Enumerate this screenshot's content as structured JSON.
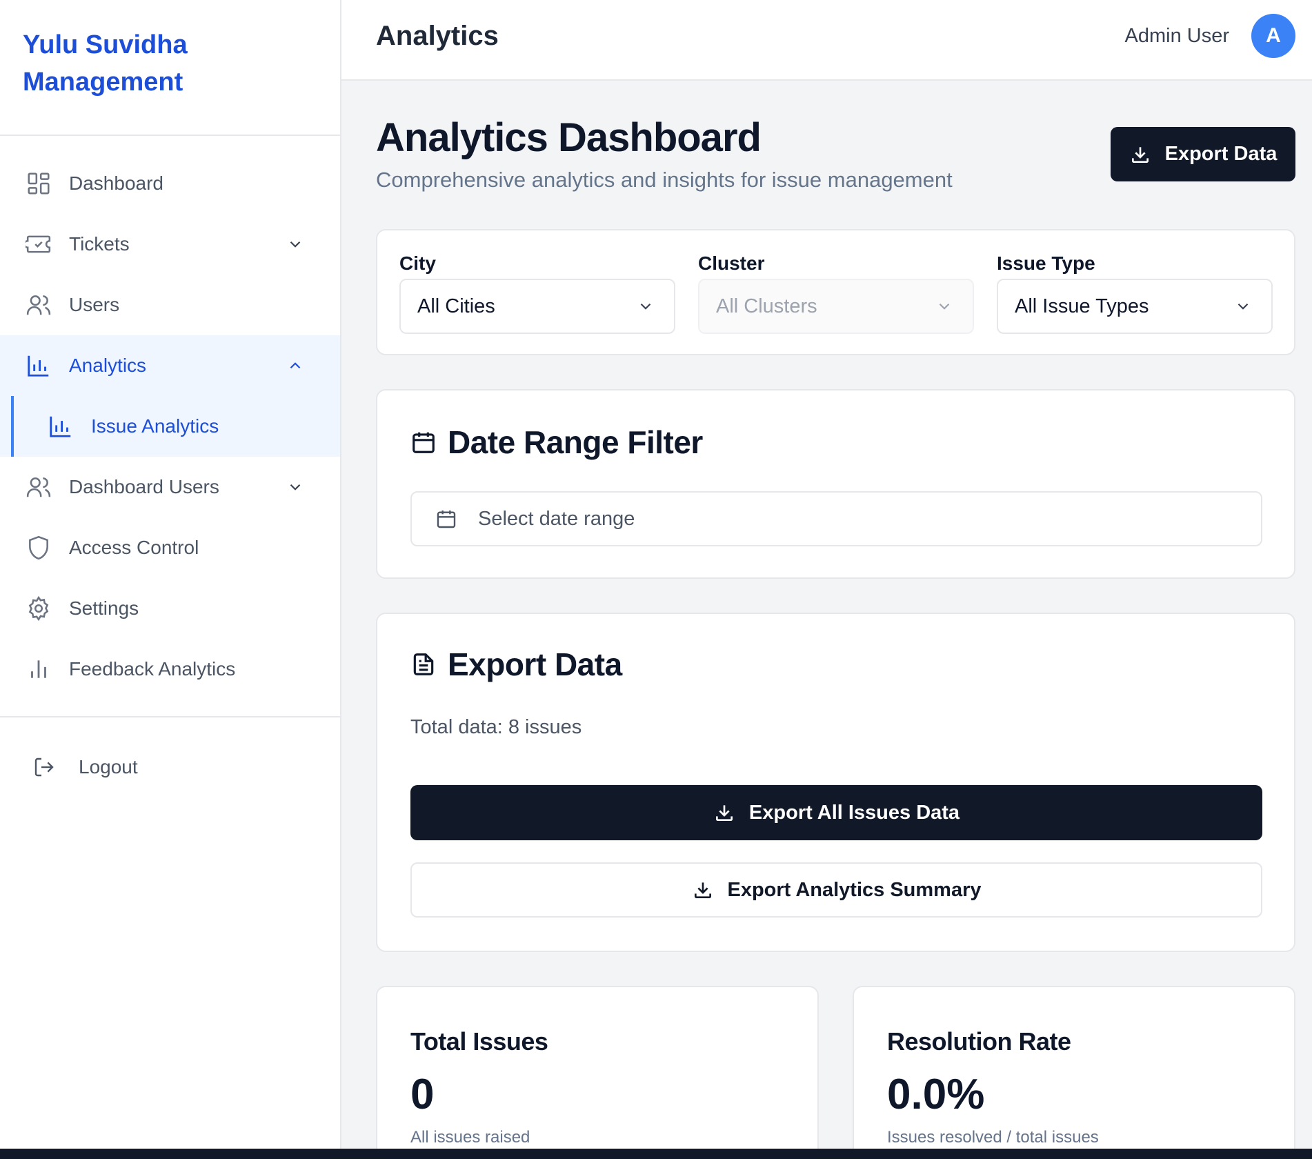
{
  "brand": {
    "title": "Yulu Suvidha Management"
  },
  "sidebar": {
    "items": [
      {
        "label": "Dashboard"
      },
      {
        "label": "Tickets"
      },
      {
        "label": "Users"
      },
      {
        "label": "Analytics"
      },
      {
        "label": "Issue Analytics"
      },
      {
        "label": "Dashboard Users"
      },
      {
        "label": "Access Control"
      },
      {
        "label": "Settings"
      },
      {
        "label": "Feedback Analytics"
      }
    ],
    "logout": "Logout",
    "active_item": "Issue Analytics"
  },
  "topbar": {
    "title": "Analytics",
    "user_name": "Admin User",
    "avatar_initial": "A"
  },
  "page": {
    "title": "Analytics Dashboard",
    "subtitle": "Comprehensive analytics and insights for issue management",
    "export_button": "Export Data"
  },
  "filters": {
    "city": {
      "label": "City",
      "value": "All Cities"
    },
    "cluster": {
      "label": "Cluster",
      "value": "All Clusters",
      "disabled": true
    },
    "issue_type": {
      "label": "Issue Type",
      "value": "All Issue Types"
    }
  },
  "date_range": {
    "heading": "Date Range Filter",
    "placeholder": "Select date range"
  },
  "export": {
    "heading": "Export Data",
    "total": "Total data: 8 issues",
    "export_all": "Export All Issues Data",
    "export_summary": "Export Analytics Summary"
  },
  "stats": [
    {
      "title": "Total Issues",
      "value": "0",
      "desc": "All issues raised"
    },
    {
      "title": "Resolution Rate",
      "value": "0.0%",
      "desc": "Issues resolved / total issues"
    }
  ],
  "colors": {
    "accent": "#1d4ed8",
    "active_bg": "#eff6ff",
    "dark_button": "#111827",
    "avatar": "#3b82f6"
  }
}
